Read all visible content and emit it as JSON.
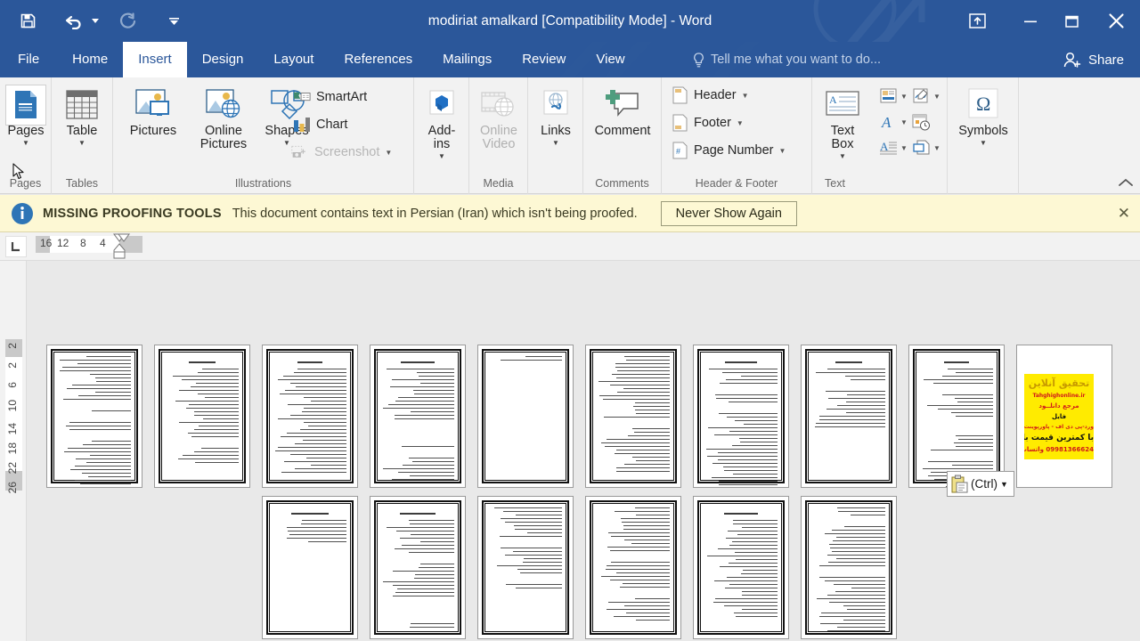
{
  "window": {
    "title": "modiriat amalkard [Compatibility Mode] - Word",
    "quick_access": [
      {
        "name": "save",
        "icon": "save-icon",
        "state": "enabled"
      },
      {
        "name": "undo",
        "icon": "undo-icon",
        "state": "enabled",
        "has_dropdown": true
      },
      {
        "name": "redo",
        "icon": "redo-icon",
        "state": "disabled"
      },
      {
        "name": "customize-quick-access-toolbar",
        "icon": "chevron-down-icon",
        "state": "enabled"
      }
    ],
    "controls": [
      {
        "name": "ribbon-display-options",
        "icon": "ribbon-display-icon",
        "glyph": "⤒"
      },
      {
        "name": "minimize",
        "icon": "minimize-icon",
        "glyph": "–"
      },
      {
        "name": "restore",
        "icon": "restore-icon",
        "glyph": "☐"
      },
      {
        "name": "close",
        "icon": "close-icon",
        "glyph": "✕"
      }
    ],
    "accent_color": "#2b579a"
  },
  "tabs": [
    {
      "label": "File",
      "active": false
    },
    {
      "label": "Home",
      "active": false
    },
    {
      "label": "Insert",
      "active": true
    },
    {
      "label": "Design",
      "active": false
    },
    {
      "label": "Layout",
      "active": false
    },
    {
      "label": "References",
      "active": false
    },
    {
      "label": "Mailings",
      "active": false
    },
    {
      "label": "Review",
      "active": false
    },
    {
      "label": "View",
      "active": false
    }
  ],
  "tellme": {
    "placeholder": "Tell me what you want to do...",
    "icon": "lightbulb-icon"
  },
  "share": {
    "label": "Share",
    "icon": "person-add-icon"
  },
  "ribbon": {
    "groups": [
      {
        "name": "Pages",
        "label": "Pages",
        "buttons": [
          {
            "label": "Pages",
            "icon": "cover-page-icon",
            "dropdown": true,
            "hovered": true
          }
        ]
      },
      {
        "name": "Tables",
        "label": "Tables",
        "buttons": [
          {
            "label": "Table",
            "icon": "table-icon",
            "dropdown": true
          }
        ]
      },
      {
        "name": "Illustrations",
        "label": "Illustrations",
        "buttons": [
          {
            "label": "Pictures",
            "icon": "pictures-icon",
            "dropdown": false
          },
          {
            "label": "Online\nPictures",
            "icon": "online-pictures-icon",
            "dropdown": false
          },
          {
            "label": "Shapes",
            "icon": "shapes-icon",
            "dropdown": true
          }
        ],
        "small_buttons": [
          {
            "label": "SmartArt",
            "icon": "smartart-icon",
            "disabled": false
          },
          {
            "label": "Chart",
            "icon": "chart-icon",
            "disabled": false
          },
          {
            "label": "Screenshot",
            "icon": "screenshot-icon",
            "disabled": true,
            "dropdown": true
          }
        ]
      },
      {
        "name": "Add-ins",
        "label": "",
        "buttons": [
          {
            "label": "Add-\nins",
            "icon": "addins-icon",
            "dropdown": true
          }
        ]
      },
      {
        "name": "Media",
        "label": "Media",
        "buttons": [
          {
            "label": "Online\nVideo",
            "icon": "online-video-icon",
            "disabled": true
          }
        ]
      },
      {
        "name": "Links",
        "label": "",
        "buttons": [
          {
            "label": "Links",
            "icon": "links-icon",
            "dropdown": true
          }
        ]
      },
      {
        "name": "Comments",
        "label": "Comments",
        "buttons": [
          {
            "label": "Comment",
            "icon": "comment-icon"
          }
        ]
      },
      {
        "name": "Header & Footer",
        "label": "Header & Footer",
        "small_buttons": [
          {
            "label": "Header",
            "icon": "header-icon",
            "dropdown": true
          },
          {
            "label": "Footer",
            "icon": "footer-icon",
            "dropdown": true
          },
          {
            "label": "Page Number",
            "icon": "page-number-icon",
            "dropdown": true
          }
        ]
      },
      {
        "name": "Text",
        "label": "Text",
        "buttons": [
          {
            "label": "Text\nBox",
            "icon": "text-box-icon",
            "dropdown": true
          }
        ],
        "mini_buttons": [
          {
            "icon": "quick-parts-icon",
            "dropdown": true
          },
          {
            "icon": "signature-line-icon",
            "dropdown": true
          },
          {
            "icon": "wordart-icon",
            "dropdown": true
          },
          {
            "icon": "date-time-icon",
            "dropdown": false
          },
          {
            "icon": "drop-cap-icon",
            "dropdown": true
          },
          {
            "icon": "object-icon",
            "dropdown": true
          }
        ]
      },
      {
        "name": "Symbols",
        "label": "",
        "buttons": [
          {
            "label": "Symbols",
            "icon": "omega-icon",
            "dropdown": true
          }
        ]
      }
    ],
    "collapse": {
      "name": "collapse-ribbon",
      "icon": "chevron-up-icon",
      "glyph": "∧"
    }
  },
  "infobar": {
    "icon": "info-icon",
    "title": "MISSING PROOFING TOOLS",
    "text": "This document contains text in Persian (Iran) which isn't being proofed.",
    "button": "Never Show Again",
    "close": "✕",
    "background": "#fdf8d4"
  },
  "rulers": {
    "horizontal": {
      "ticks": [
        "16",
        "12",
        "8",
        "4"
      ],
      "tab_stop_icon": "left-tab-stop-icon"
    },
    "vertical": {
      "ticks": [
        "2",
        "2",
        "6",
        "10",
        "14",
        "18",
        "22",
        "26"
      ]
    }
  },
  "document": {
    "zoom_layout": "multi-page",
    "row1_count": 10,
    "row2_count": 6,
    "ad_page": {
      "background": "#ffeb00",
      "lines": [
        {
          "text": "تحقیق آنلاین",
          "color": "#c89a00",
          "size": 11,
          "bold": true
        },
        {
          "text": "Tahghighonline.ir",
          "color": "#d11a1a",
          "size": 6,
          "bold": true
        },
        {
          "text": "مرجع دانلــود",
          "color": "#d11a1a",
          "size": 7,
          "bold": true
        },
        {
          "text": "فایل",
          "color": "#111111",
          "size": 7,
          "bold": true
        },
        {
          "text": "ورد-پی دی اف - پاورپوینت",
          "color": "#d11a1a",
          "size": 6,
          "bold": true
        },
        {
          "text": "با کمترین قیمت بازار",
          "color": "#111111",
          "size": 9,
          "bold": true
        },
        {
          "text": "09981366624 واتساپ",
          "color": "#d11a1a",
          "size": 7,
          "bold": true
        }
      ]
    }
  },
  "paste_options": {
    "label": "(Ctrl)",
    "icon": "paste-clipboard-icon",
    "caret": "▼"
  },
  "cursor": {
    "icon": "mouse-pointer-icon"
  }
}
